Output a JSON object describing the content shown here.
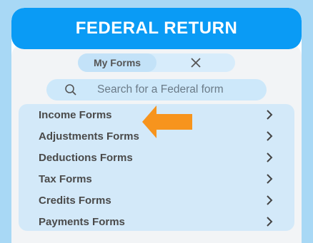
{
  "header": {
    "title": "FEDERAL RETURN"
  },
  "tabs": {
    "active_label": "My Forms"
  },
  "search": {
    "placeholder": "Search for a Federal form"
  },
  "list": {
    "items": [
      {
        "label": "Income Forms"
      },
      {
        "label": "Adjustments Forms"
      },
      {
        "label": "Deductions Forms"
      },
      {
        "label": "Tax Forms"
      },
      {
        "label": "Credits Forms"
      },
      {
        "label": "Payments Forms"
      }
    ]
  },
  "colors": {
    "header": "#0a9bf5",
    "accent_arrow": "#f7941d",
    "list_bg": "#d3e9f9",
    "page_bg": "#a8d8f5"
  },
  "icons": {
    "close": "close-icon",
    "search": "search-icon",
    "chevron": "chevron-right-icon",
    "pointer": "arrow-left-icon"
  }
}
